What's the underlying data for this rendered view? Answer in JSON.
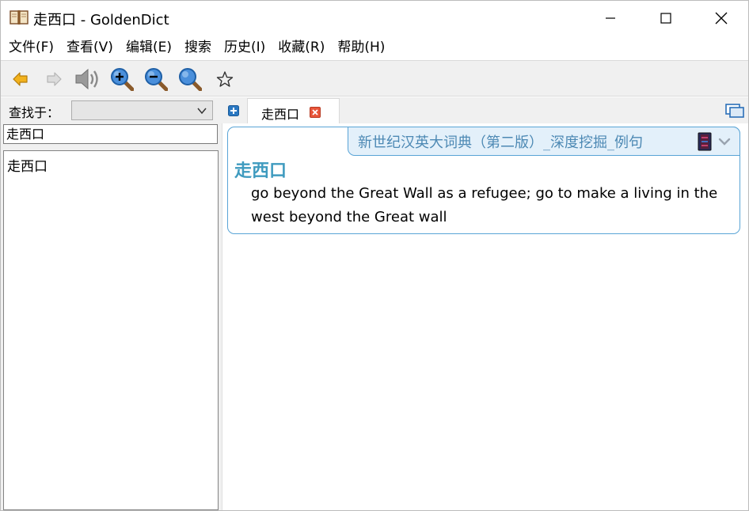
{
  "window": {
    "title": "走西口 - GoldenDict"
  },
  "menu": {
    "items": [
      "文件(F)",
      "查看(V)",
      "编辑(E)",
      "搜索",
      "历史(I)",
      "收藏(R)",
      "帮助(H)"
    ]
  },
  "toolbar": {
    "buttons": [
      {
        "icon": "back-arrow-icon",
        "color": "#f2b21d"
      },
      {
        "icon": "forward-arrow-icon",
        "color": "#c8c8c8"
      },
      {
        "icon": "speaker-icon",
        "color": "#8a8a8a"
      },
      {
        "icon": "zoom-in-icon",
        "color": "#2d7fd1"
      },
      {
        "icon": "zoom-out-icon",
        "color": "#2d7fd1"
      },
      {
        "icon": "zoom-reset-icon",
        "color": "#2d7fd1"
      },
      {
        "icon": "star-icon",
        "color": "#333333"
      }
    ]
  },
  "left_pane": {
    "lookup_label": "查找于：",
    "group_select_value": "",
    "search_value": "走西口",
    "word_list": [
      "走西口"
    ]
  },
  "tabs": [
    {
      "label": "走西口",
      "active": true
    }
  ],
  "article": {
    "dictionary_name": "新世纪汉英大词典（第二版）_深度挖掘_例句",
    "headword": "走西口",
    "definition": "go beyond the Great Wall as a refugee; go to make a living in the west beyond the Great wall",
    "accent_color": "#3f9bbf",
    "border_color": "#59a4d6"
  }
}
